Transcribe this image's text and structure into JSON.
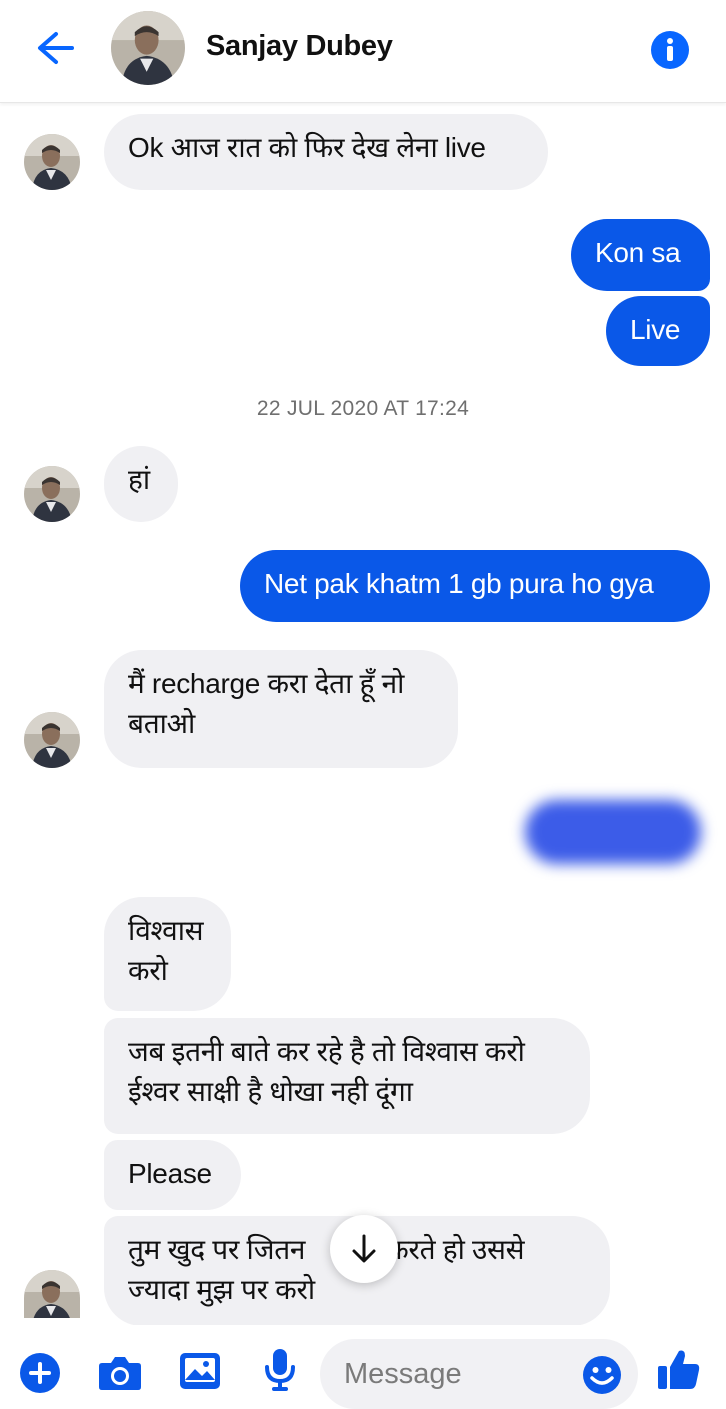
{
  "header": {
    "contact_name": "Sanjay Dubey",
    "back_icon": "back-arrow-icon",
    "info_icon": "info-icon"
  },
  "messages": [
    {
      "from": "them",
      "text": "Ok आज रात को फिर देख लेना live"
    },
    {
      "from": "me",
      "text": "Kon sa"
    },
    {
      "from": "me",
      "text": "Live"
    },
    {
      "from": "them",
      "text": "हां"
    },
    {
      "from": "me",
      "text": "Net pak khatm 1 gb pura ho gya"
    },
    {
      "from": "them",
      "lines": [
        "मैं recharge करा देता हूँ नो",
        "बताओ"
      ]
    },
    {
      "from": "them",
      "lines": [
        "विश्वास",
        "करो"
      ]
    },
    {
      "from": "them",
      "lines": [
        "जब इतनी बाते कर रहे है तो विश्वास करो",
        "ईश्वर साक्षी है धोखा नही दूंगा"
      ]
    },
    {
      "from": "them",
      "text": "Please"
    },
    {
      "from": "them",
      "lines": [
        "तुम खुद पर जितन",
        "स करते हो उससे",
        "ज्यादा मुझ पर करो"
      ]
    }
  ],
  "timestamp": "22 JUL 2020 AT 17:24",
  "composer": {
    "placeholder": "Message",
    "icons": [
      "plus-icon",
      "camera-icon",
      "gallery-icon",
      "microphone-icon",
      "emoji-icon",
      "thumbs-up-icon"
    ]
  },
  "colors": {
    "accent": "#0a58e8",
    "incoming_bubble": "#f0f0f3",
    "icon_blue": "#0866ff"
  }
}
